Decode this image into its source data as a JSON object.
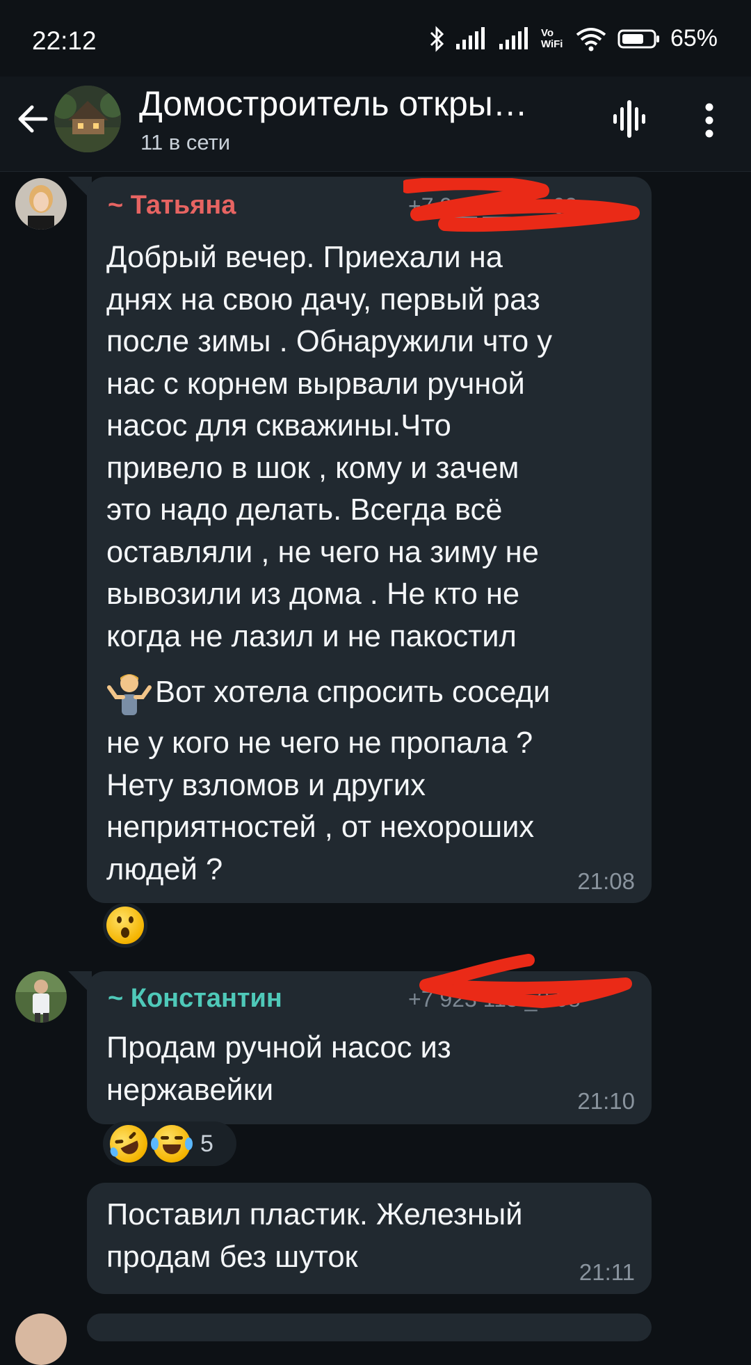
{
  "status_bar": {
    "time": "22:12",
    "network_label": "Vo WiFi",
    "battery": "65%",
    "icons": [
      "bluetooth-icon",
      "signal-icon",
      "signal-icon",
      "vowifi-icon",
      "wifi-icon",
      "battery-icon"
    ]
  },
  "header": {
    "title": "Домостроитель откры…",
    "subtitle": "11 в сети"
  },
  "messages": [
    {
      "sender": "~ Татьяна",
      "phone": "+7 9__ ___-__62",
      "text_1": "Добрый вечер. Приехали на\nднях на свою дачу, первый раз\nпосле зимы . Обнаружили что у\nнас с корнем вырвали ручной\nнасос для скважины.Что\nпривело в шок , кому и зачем\nэто надо делать. Всегда всё\nоставляли , не чего на зиму не\nвывозили из дома . Не кто не\nкогда не лазил и не пакостил",
      "text_2": "Вот хотела спросить соседи",
      "text_3": "не у кого не чего не пропала ?\nНету взломов и других\nнеприятностей , от нехороших\nлюдей ?",
      "time": "21:08",
      "reaction": "surprised-face"
    },
    {
      "sender": "~ Константин",
      "phone": "+7 923 115 _0 08",
      "text": "Продам ручной насос из\nнержавейки",
      "time": "21:10",
      "reactions": [
        "rolling-laughing-face",
        "tears-of-joy-face"
      ],
      "reaction_count": "5"
    },
    {
      "text": "Поставил пластик. Железный\nпродам без шуток",
      "time": "21:11"
    }
  ],
  "colors": {
    "background": "#0d1115",
    "bubble": "#212930",
    "sender_1": "#e76462",
    "sender_2": "#4fc9b9",
    "redaction": "#ea2a17"
  }
}
